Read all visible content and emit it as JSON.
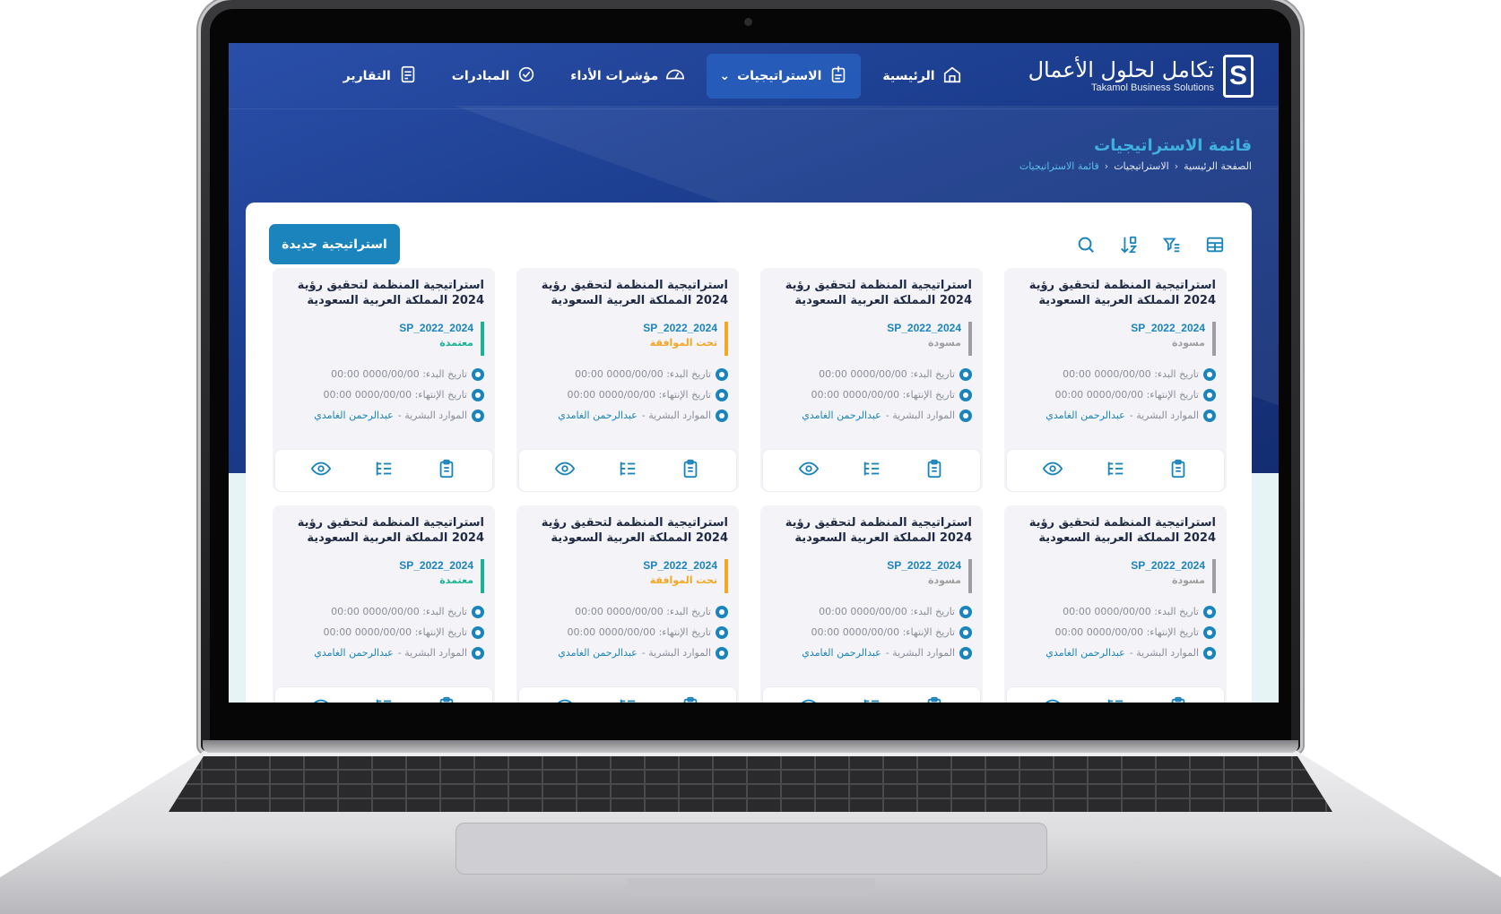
{
  "brand": {
    "name_ar": "تكامل لحلول الأعمال",
    "name_en": "Takamol Business Solutions",
    "logo_letter": "S"
  },
  "nav": [
    {
      "label": "الرئيسية",
      "icon": "home-icon",
      "active": false
    },
    {
      "label": "الاستراتيجيات",
      "icon": "strategy-icon",
      "active": true,
      "dropdown": true
    },
    {
      "label": "مؤشرات الأداء",
      "icon": "gauge-icon",
      "active": false
    },
    {
      "label": "المبادرات",
      "icon": "initiatives-icon",
      "active": false
    },
    {
      "label": "التقارير",
      "icon": "reports-icon",
      "active": false
    }
  ],
  "page": {
    "title": "قائمة الاستراتيجيات",
    "breadcrumb": [
      "الصفحة الرئيسية",
      "الاستراتيجيات",
      "قائمة الاستراتيجيات"
    ]
  },
  "toolbar": {
    "new_button": "استراتيجية جديدة",
    "icons": [
      "table-view-icon",
      "filter-icon",
      "sort-icon",
      "search-icon"
    ]
  },
  "labels": {
    "start": "تاريخ البدء: 0000/00/00 00:00",
    "end": "تاريخ الإنتهاء: 0000/00/00 00:00",
    "dept": "الموارد البشرية - ",
    "owner": "عبدالرحمن الغامدي"
  },
  "cards": [
    {
      "title": "استراتيجية المنظمة لتحقيق رؤية 2024 المملكة العربية السعودية",
      "code": "SP_2022_2024",
      "status": "مسودة",
      "status_color": "#9e9e9e"
    },
    {
      "title": "استراتيجية المنظمة لتحقيق رؤية 2024 المملكة العربية السعودية",
      "code": "SP_2022_2024",
      "status": "مسودة",
      "status_color": "#9e9e9e"
    },
    {
      "title": "استراتيجية المنظمة لتحقيق رؤية 2024 المملكة العربية السعودية",
      "code": "SP_2022_2024",
      "status": "تحت الموافقة",
      "status_color": "#f5a623"
    },
    {
      "title": "استراتيجية المنظمة لتحقيق رؤية 2024 المملكة العربية السعودية",
      "code": "SP_2022_2024",
      "status": "معتمدة",
      "status_color": "#19b394"
    },
    {
      "title": "استراتيجية المنظمة لتحقيق رؤية 2024 المملكة العربية السعودية",
      "code": "SP_2022_2024",
      "status": "مسودة",
      "status_color": "#9e9e9e"
    },
    {
      "title": "استراتيجية المنظمة لتحقيق رؤية 2024 المملكة العربية السعودية",
      "code": "SP_2022_2024",
      "status": "مسودة",
      "status_color": "#9e9e9e"
    },
    {
      "title": "استراتيجية المنظمة لتحقيق رؤية 2024 المملكة العربية السعودية",
      "code": "SP_2022_2024",
      "status": "تحت الموافقة",
      "status_color": "#f5a623"
    },
    {
      "title": "استراتيجية المنظمة لتحقيق رؤية 2024 المملكة العربية السعودية",
      "code": "SP_2022_2024",
      "status": "معتمدة",
      "status_color": "#19b394"
    }
  ],
  "colors": {
    "primary": "#1b84bd",
    "hero": "#1b3c8c",
    "accent": "#3fb0e0"
  }
}
